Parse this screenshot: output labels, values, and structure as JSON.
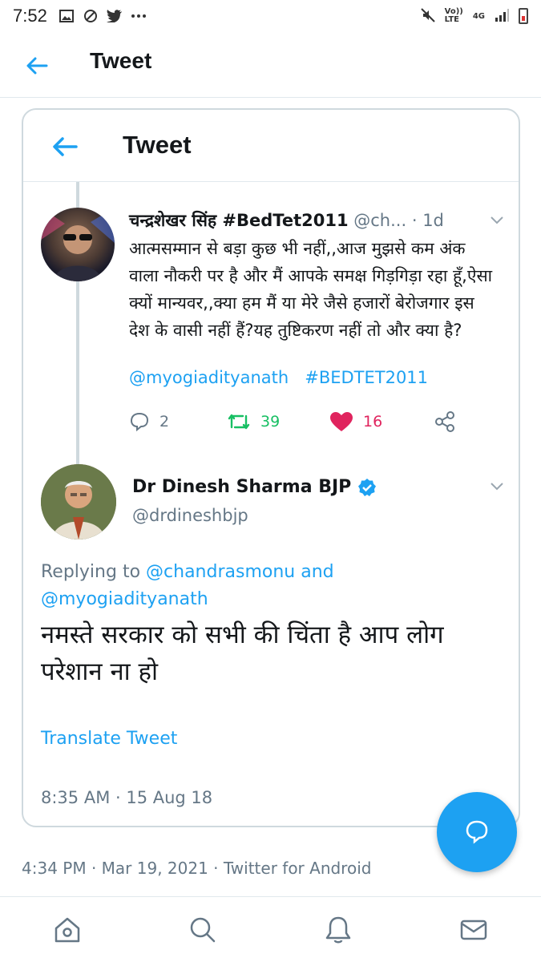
{
  "status_bar": {
    "time": "7:52",
    "network_top": "Vo))",
    "network_bottom": "LTE",
    "signal_label": "4G"
  },
  "header": {
    "title": "Tweet"
  },
  "embedded_card": {
    "header_title": "Tweet",
    "parent_tweet": {
      "author_name": "चन्द्रशेखर सिंह #BedTet2011",
      "handle_truncated": "@ch...",
      "age": "· 1d",
      "text": "आत्मसम्मान से बड़ा कुछ भी नहीं,,आज मुझसे कम अंक वाला नौकरी पर है और मैं आपके समक्ष गिड़गिड़ा रहा हूँ,ऐसा क्यों मान्यवर,,क्या हम मैं या मेरे जैसे हजारों बेरोजगार इस देश के वासी नहीं हैं?यह तुष्टिकरण नहीं तो और क्या है?",
      "mention": "@myogiadityanath",
      "hashtag": "#BEDTET2011",
      "reply_count": "2",
      "retweet_count": "39",
      "like_count": "16"
    },
    "reply_tweet": {
      "author_name": "Dr Dinesh Sharma BJP",
      "handle": "@drdineshbjp",
      "replying_prefix": "Replying to",
      "replying_mention_1": "@chandrasmonu",
      "replying_and": "and",
      "replying_mention_2": "@myogiadityanath",
      "text": "नमस्ते सरकार को सभी की चिंता है आप लोग परेशान ना हो",
      "translate_label": "Translate Tweet",
      "timestamp": "8:35 AM · 15 Aug 18"
    }
  },
  "outer_timestamp": "4:34 PM · Mar 19, 2021 · Twitter for Android",
  "colors": {
    "accent": "#1da1f2",
    "secondary_text": "#657786",
    "retweet": "#17bf63",
    "like": "#e0245e",
    "verified": "#1da1f2"
  },
  "nav": {
    "items": [
      "home-icon",
      "search-icon",
      "notifications-icon",
      "messages-icon"
    ]
  }
}
